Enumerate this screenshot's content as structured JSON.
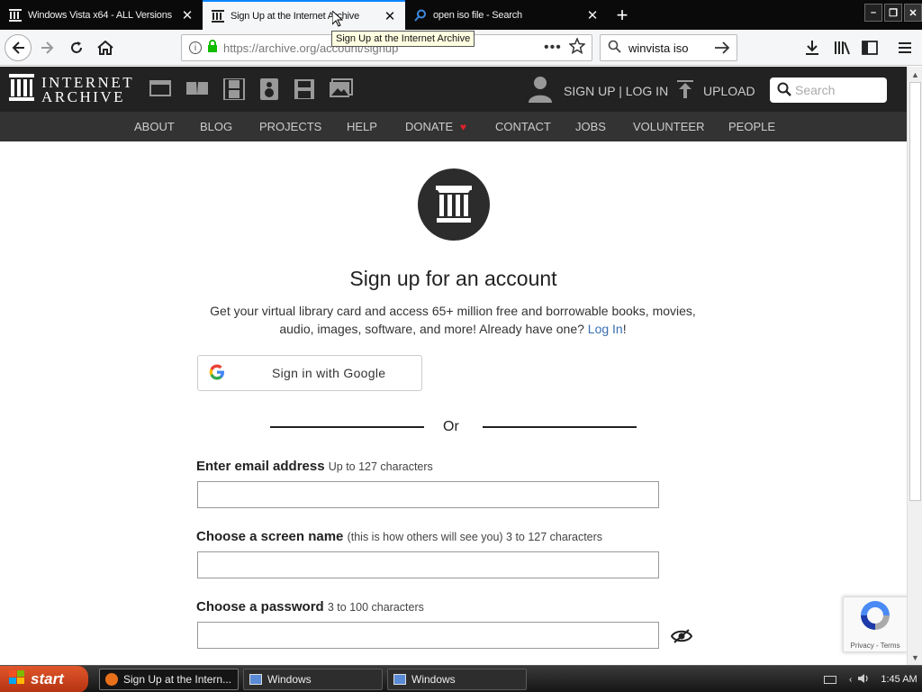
{
  "browser": {
    "tabs": [
      {
        "title": "Windows Vista x64 - ALL Versions",
        "favicon": "ia-columns-icon",
        "state": "inactive"
      },
      {
        "title": "Sign Up at the Internet Archive",
        "favicon": "ia-columns-icon",
        "state": "active"
      },
      {
        "title": "open iso file - Search",
        "favicon": "search-icon",
        "state": "inactive"
      }
    ],
    "tooltip": "Sign Up at the Internet Archive",
    "url": "https://archive.org/account/signup",
    "search_value": "winvista iso"
  },
  "ia_header": {
    "logo_line1": "INTERNET",
    "logo_line2": "ARCHIVE",
    "media_icons": [
      "web-icon",
      "texts-icon",
      "video-icon",
      "audio-icon",
      "software-icon",
      "images-icon"
    ],
    "user_link": "SIGN UP | LOG IN",
    "upload_link": "UPLOAD",
    "search_placeholder": "Search",
    "nav": [
      "ABOUT",
      "BLOG",
      "PROJECTS",
      "HELP",
      "DONATE",
      "CONTACT",
      "JOBS",
      "VOLUNTEER",
      "PEOPLE"
    ],
    "donate_heart_color": "#e0222a"
  },
  "signup": {
    "title": "Sign up for an account",
    "desc_text": "Get your virtual library card and access 65+ million free and borrowable books, movies, audio, images, software, and more! Already have one?",
    "login_link": "Log In",
    "desc_end": "!",
    "google_button": "Sign in with Google",
    "or_text": "Or",
    "email_label": "Enter email address",
    "email_hint": "Up to 127 characters",
    "email_value": "",
    "screen_name_label": "Choose a screen name",
    "screen_name_hint": "(this is how others will see you) 3 to 127 characters",
    "screen_name_value": "",
    "password_label": "Choose a password",
    "password_hint": "3 to 100 characters",
    "password_value": ""
  },
  "recaptcha": {
    "links": "Privacy - Terms"
  },
  "taskbar": {
    "start_label": "start",
    "tasks": [
      "Sign Up at the Intern...",
      "Windows",
      "Windows"
    ],
    "clock": "1:45 AM"
  },
  "colors": {
    "ia_header_bg": "#222222",
    "ia_nav_bg": "#333333",
    "link_blue": "#3a6fb0",
    "tab_accent": "#0a84ff",
    "start_orange": "#c9441b"
  }
}
